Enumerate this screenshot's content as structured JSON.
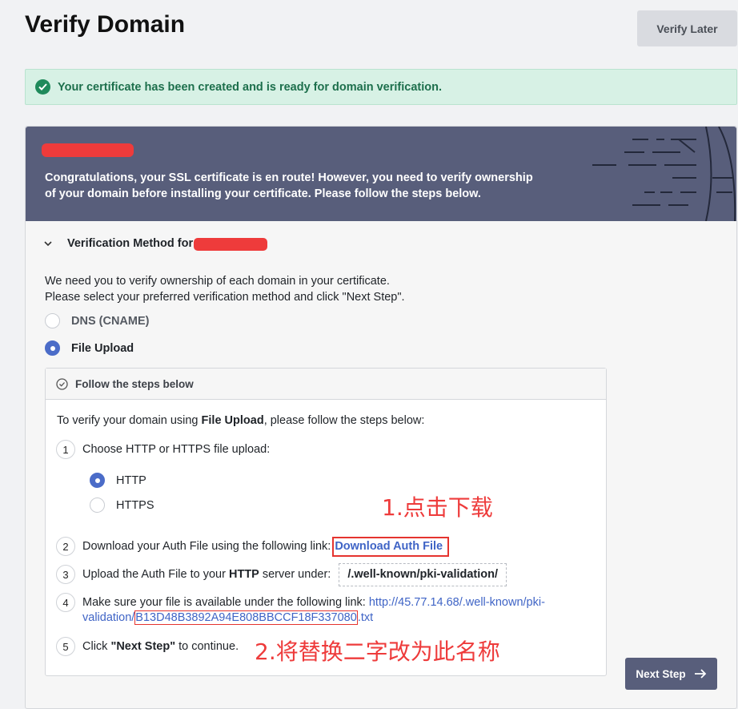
{
  "page": {
    "title": "Verify Domain",
    "verify_later_label": "Verify Later"
  },
  "alert": {
    "text": "Your certificate has been created and is ready for domain verification."
  },
  "banner": {
    "line1": "Congratulations, your SSL certificate is en route! However, you need to verify ownership",
    "line2": "of your domain before installing your certificate. Please follow the steps below."
  },
  "section": {
    "title": "Verification Method for"
  },
  "intro": {
    "line1": "We need you to verify ownership of each domain in your certificate.",
    "line2": "Please select your preferred verification method and click \"Next Step\"."
  },
  "methods": [
    {
      "label": "DNS (CNAME)",
      "selected": false
    },
    {
      "label": "File Upload",
      "selected": true
    }
  ],
  "steps_box": {
    "header": "Follow the steps below",
    "intro_prefix": "To verify your domain using ",
    "intro_bold": "File Upload",
    "intro_suffix": ", please follow the steps below:",
    "step1": {
      "num": "1",
      "text": "Choose HTTP or HTTPS file upload:"
    },
    "protocols": [
      {
        "label": "HTTP",
        "selected": true
      },
      {
        "label": "HTTPS",
        "selected": false
      }
    ],
    "step2": {
      "num": "2",
      "text": "Download your Auth File using the following link:",
      "link": "Download Auth File"
    },
    "step3": {
      "num": "3",
      "text_prefix": "Upload the Auth File to your ",
      "text_bold": "HTTP",
      "text_suffix": " server under:",
      "path": "/.well-known/pki-validation/"
    },
    "step4": {
      "num": "4",
      "text": "Make sure your file is available under the following link: ",
      "url_a": "http://45.77.14.68/.well-known/pki-",
      "url_b": "validation/",
      "url_hash": "B13D48B3892A94E808BBCCF18F337080",
      "url_ext": ".txt"
    },
    "step5": {
      "num": "5",
      "prefix": "Click ",
      "bold": "\"Next Step\"",
      "suffix": " to continue."
    }
  },
  "annotations": {
    "a1": "1.点击下载",
    "a2": "2.将替换二字改为此名称"
  },
  "next_button_label": "Next Step",
  "colors": {
    "banner": "#585e7b",
    "accent": "#4b6cc8",
    "success": "#1f8a5b",
    "annotation": "#ee3b3b"
  }
}
